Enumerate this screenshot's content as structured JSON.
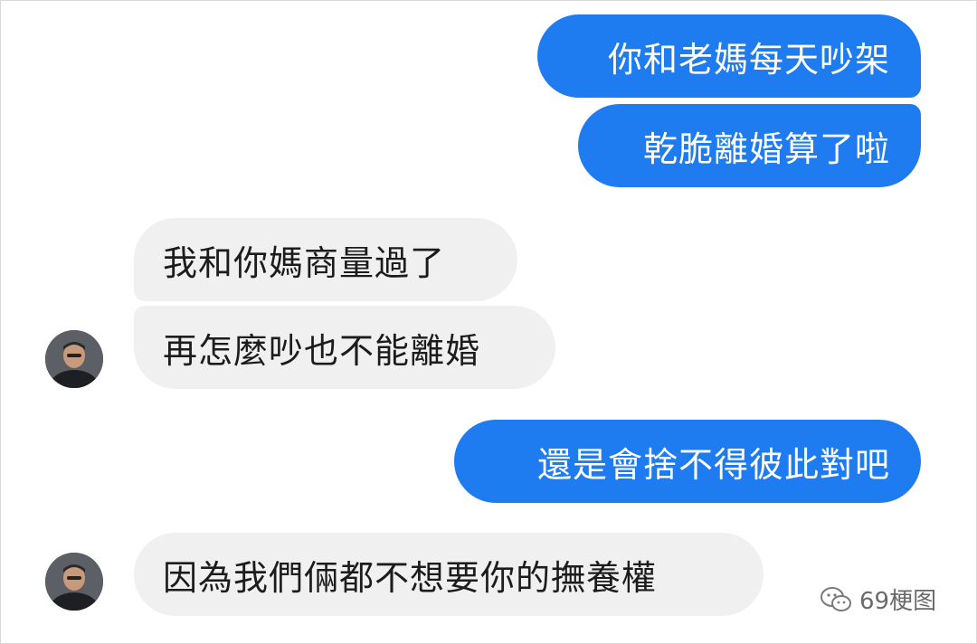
{
  "messages": [
    {
      "side": "outgoing",
      "text": "你和老媽每天吵架"
    },
    {
      "side": "outgoing",
      "text": "乾脆離婚算了啦"
    },
    {
      "side": "incoming",
      "text": "我和你媽商量過了"
    },
    {
      "side": "incoming",
      "text": "再怎麼吵也不能離婚"
    },
    {
      "side": "outgoing",
      "text": "還是會捨不得彼此對吧"
    },
    {
      "side": "incoming",
      "text": "因為我們倆都不想要你的撫養權"
    }
  ],
  "watermark": {
    "icon": "wechat-icon",
    "text": "69梗图"
  },
  "colors": {
    "outgoing_bubble": "#1f7bf0",
    "incoming_bubble": "#f0f0f0",
    "background": "#ffffff"
  }
}
